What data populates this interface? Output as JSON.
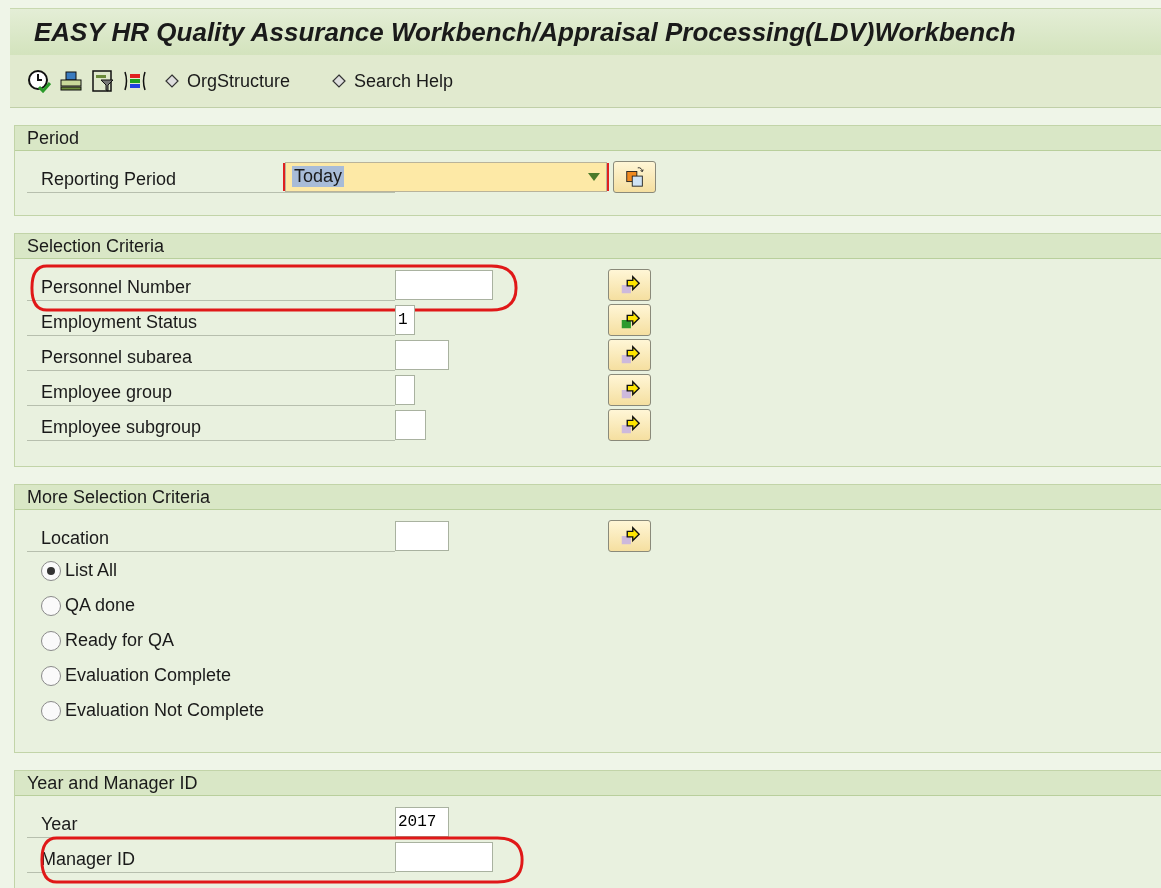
{
  "title": "EASY HR Quality Assurance Workbench/Appraisal Processing(LDV)Workbench",
  "toolbar": {
    "buttons": [
      {
        "label": "OrgStructure"
      },
      {
        "label": "Search Help"
      }
    ]
  },
  "period": {
    "title": "Period",
    "label": "Reporting Period",
    "value": "Today",
    "required": true
  },
  "selection": {
    "title": "Selection Criteria",
    "rows": [
      {
        "label": "Personnel Number",
        "highlighted": true,
        "filled": false
      },
      {
        "label": "Employment Status",
        "value": "1",
        "highlighted": false,
        "filled": true
      },
      {
        "label": "Personnel subarea",
        "highlighted": false,
        "filled": false
      },
      {
        "label": "Employee group",
        "highlighted": false,
        "filled": false
      },
      {
        "label": "Employee subgroup",
        "highlighted": false,
        "filled": false
      }
    ]
  },
  "more": {
    "title": "More Selection Criteria",
    "rows": [
      {
        "label": "Location",
        "highlighted": false,
        "filled": false
      }
    ],
    "options": [
      {
        "label": "List All",
        "selected": true
      },
      {
        "label": "QA done",
        "selected": false
      },
      {
        "label": "Ready for QA",
        "selected": false
      },
      {
        "label": "Evaluation Complete",
        "selected": false
      },
      {
        "label": "Evaluation Not Complete",
        "selected": false
      }
    ]
  },
  "year": {
    "title": "Year and Manager ID",
    "rows": [
      {
        "label": "Year",
        "value": "2017",
        "highlighted": false
      },
      {
        "label": "Manager ID",
        "highlighted": true
      }
    ]
  }
}
